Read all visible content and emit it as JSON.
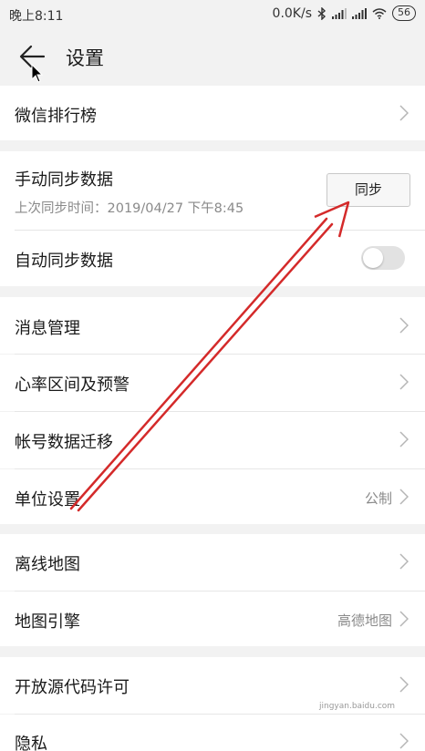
{
  "status_bar": {
    "time": "晚上8:11",
    "speed": "0.0K/s",
    "battery": "56",
    "icons": [
      "bluetooth-icon",
      "signal-icon",
      "signal-icon",
      "wifi-icon",
      "battery-icon"
    ]
  },
  "header": {
    "title": "设置",
    "back_icon": "back-arrow-icon"
  },
  "rows": {
    "wechat_rank": {
      "label": "微信排行榜"
    },
    "manual_sync": {
      "label": "手动同步数据",
      "sub": "上次同步时间：2019/04/27 下午8:45",
      "button": "同步"
    },
    "auto_sync": {
      "label": "自动同步数据",
      "toggle_on": false
    },
    "messages": {
      "label": "消息管理"
    },
    "heart_rate": {
      "label": "心率区间及预警"
    },
    "account_migrate": {
      "label": "帐号数据迁移"
    },
    "units": {
      "label": "单位设置",
      "value": "公制"
    },
    "offline_map": {
      "label": "离线地图"
    },
    "map_engine": {
      "label": "地图引擎",
      "value": "高德地图"
    },
    "open_source": {
      "label": "开放源代码许可"
    },
    "privacy": {
      "label": "隐私"
    }
  },
  "annotation": {
    "color": "#d42a2a"
  },
  "watermark": {
    "text": "jingyan.baidu.com"
  }
}
